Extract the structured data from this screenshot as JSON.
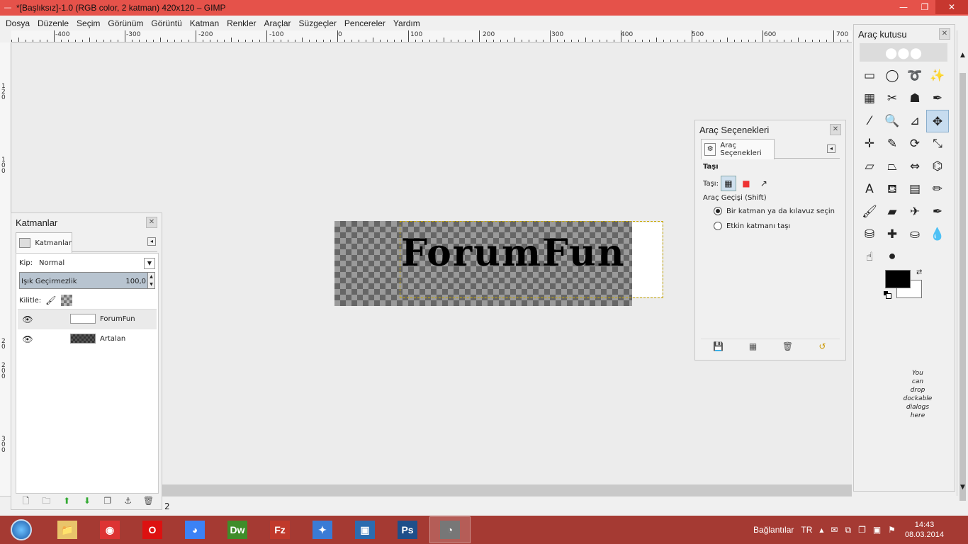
{
  "window": {
    "title": "*[Başlıksız]-1.0 (RGB color, 2 katman) 420x120 – GIMP",
    "minimize": "—",
    "maximize": "❐",
    "close": "✕"
  },
  "menu": [
    "Dosya",
    "Düzenle",
    "Seçim",
    "Görünüm",
    "Görüntü",
    "Katman",
    "Renkler",
    "Araçlar",
    "Süzgeçler",
    "Pencereler",
    "Yardım"
  ],
  "ruler": {
    "h_labels": [
      "-400",
      "-300",
      "-200",
      "-100",
      "0",
      "100",
      "200",
      "300",
      "400",
      "500",
      "600",
      "700"
    ],
    "v_labels": [
      "1\n2\n0",
      "1\n0\n0",
      "2\n0",
      "2\n0\n0",
      "3\n0\n0"
    ]
  },
  "canvas": {
    "image_text": "ForumFun"
  },
  "status": {
    "zoom_value": "2"
  },
  "layers_panel": {
    "title": "Katmanlar",
    "tab_label": "Katmanlar",
    "mode_label": "Kip:",
    "mode_value": "Normal",
    "opacity_label": "Işık Geçirmezlik",
    "opacity_value": "100,0",
    "lock_label": "Kilitle:",
    "layers": [
      {
        "name": "ForumFun",
        "visible": true,
        "active": true
      },
      {
        "name": "Artalan",
        "visible": true,
        "active": false
      }
    ]
  },
  "tool_options": {
    "title": "Araç Seçenekleri",
    "tab_label": "Araç Seçenekleri",
    "tool_name": "Taşı",
    "move_label": "Taşı:",
    "mode_label": "Araç Geçişi  (Shift)",
    "option_1": "Bir katman ya da kılavuz seçin",
    "option_2": "Etkin katmanı taşı",
    "selected_option": 1
  },
  "toolbox": {
    "title": "Araç kutusu",
    "drop_hint": "You\ncan\ndrop\ndockable\ndialogs\nhere",
    "tools": [
      {
        "icon": "rect-select-icon",
        "glyph": "▭"
      },
      {
        "icon": "ellipse-select-icon",
        "glyph": "◯"
      },
      {
        "icon": "free-select-icon",
        "glyph": "➰"
      },
      {
        "icon": "fuzzy-select-icon",
        "glyph": "✨"
      },
      {
        "icon": "color-select-icon",
        "glyph": "▦"
      },
      {
        "icon": "scissors-select-icon",
        "glyph": "✂"
      },
      {
        "icon": "foreground-select-icon",
        "glyph": "☗"
      },
      {
        "icon": "paths-icon",
        "glyph": "✒"
      },
      {
        "icon": "color-picker-icon",
        "glyph": "⁄"
      },
      {
        "icon": "zoom-icon",
        "glyph": "🔍"
      },
      {
        "icon": "measure-icon",
        "glyph": "⊿"
      },
      {
        "icon": "move-icon",
        "glyph": "✥"
      },
      {
        "icon": "align-icon",
        "glyph": "✛"
      },
      {
        "icon": "crop-icon",
        "glyph": "✎"
      },
      {
        "icon": "rotate-icon",
        "glyph": "⟳"
      },
      {
        "icon": "scale-icon",
        "glyph": "⤡"
      },
      {
        "icon": "shear-icon",
        "glyph": "▱"
      },
      {
        "icon": "perspective-icon",
        "glyph": "⏢"
      },
      {
        "icon": "flip-icon",
        "glyph": "⇔"
      },
      {
        "icon": "cage-icon",
        "glyph": "⌬"
      },
      {
        "icon": "text-icon",
        "glyph": "A"
      },
      {
        "icon": "bucket-fill-icon",
        "glyph": "⛾"
      },
      {
        "icon": "blend-icon",
        "glyph": "▤"
      },
      {
        "icon": "pencil-icon",
        "glyph": "✏"
      },
      {
        "icon": "paintbrush-icon",
        "glyph": "🖌"
      },
      {
        "icon": "eraser-icon",
        "glyph": "▰"
      },
      {
        "icon": "airbrush-icon",
        "glyph": "✈"
      },
      {
        "icon": "ink-icon",
        "glyph": "✒"
      },
      {
        "icon": "clone-icon",
        "glyph": "⛁"
      },
      {
        "icon": "heal-icon",
        "glyph": "✚"
      },
      {
        "icon": "perspective-clone-icon",
        "glyph": "⛀"
      },
      {
        "icon": "blur-icon",
        "glyph": "💧"
      },
      {
        "icon": "smudge-icon",
        "glyph": "☝"
      },
      {
        "icon": "dodge-burn-icon",
        "glyph": "⚫"
      }
    ],
    "active_tool_index": 11,
    "fg_color": "#000000",
    "bg_color": "#ffffff"
  },
  "taskbar": {
    "apps": [
      {
        "name": "explorer",
        "label": "📁",
        "color": "#e9c46a"
      },
      {
        "name": "eye",
        "label": "◉",
        "color": "#d33"
      },
      {
        "name": "opera",
        "label": "O",
        "color": "#d11"
      },
      {
        "name": "chrome",
        "label": "◕",
        "color": "#3b82f6"
      },
      {
        "name": "dreamweaver",
        "label": "Dw",
        "color": "#3f8d2a"
      },
      {
        "name": "filezilla",
        "label": "Fz",
        "color": "#c0392b"
      },
      {
        "name": "bird",
        "label": "✦",
        "color": "#3a7bd5"
      },
      {
        "name": "network",
        "label": "▣",
        "color": "#2b6cb0"
      },
      {
        "name": "photoshop",
        "label": "Ps",
        "color": "#1e4f8a"
      },
      {
        "name": "gimp",
        "label": "◔",
        "color": "#777"
      }
    ],
    "active_app": 9,
    "tray_label": "Bağlantılar",
    "lang": "TR",
    "time": "14:43",
    "date": "08.03.2014"
  }
}
